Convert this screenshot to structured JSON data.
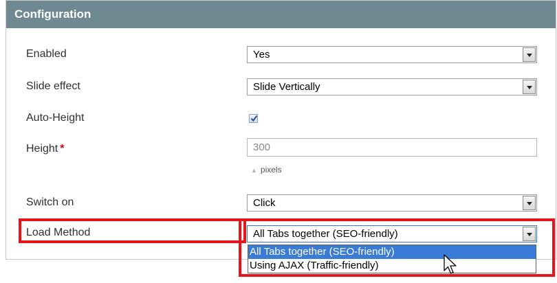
{
  "panel": {
    "title": "Configuration"
  },
  "fields": {
    "enabled": {
      "label": "Enabled",
      "value": "Yes"
    },
    "slide_effect": {
      "label": "Slide effect",
      "value": "Slide Vertically"
    },
    "auto_height": {
      "label": "Auto-Height",
      "checked": true
    },
    "height": {
      "label": "Height",
      "required_mark": "*",
      "value": "300",
      "note": "pixels"
    },
    "switch_on": {
      "label": "Switch on",
      "value": "Click"
    },
    "load_method": {
      "label": "Load Method",
      "value": "All Tabs together (SEO-friendly)",
      "options": [
        "All Tabs together (SEO-friendly)",
        "Using AJAX (Traffic-friendly)"
      ]
    }
  },
  "colors": {
    "header_bg": "#6f8992",
    "highlight": "#e8141b",
    "selected_option": "#3a7bd5"
  },
  "icons": {
    "dropdown_arrow": "chevron-down-icon",
    "checkbox": "checkmark-icon",
    "pointer": "mouse-pointer-icon"
  }
}
